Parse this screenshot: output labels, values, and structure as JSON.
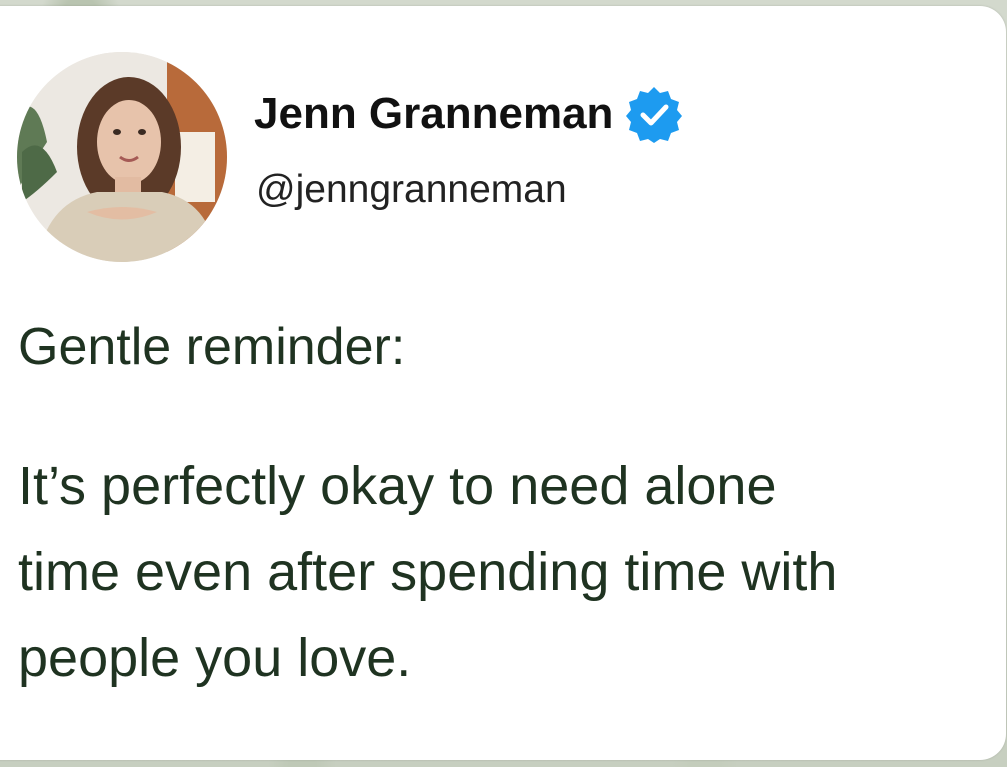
{
  "tweet": {
    "author": {
      "display_name": "Jenn Granneman",
      "handle": "@jenngranneman",
      "verified": true,
      "avatar_icon": "profile-photo"
    },
    "intro": "Gentle reminder:",
    "body_lines": [
      "It’s perfectly okay to need alone",
      "time even after spending time with",
      "people you love."
    ]
  },
  "colors": {
    "verified_badge": "#1d9bf0",
    "text": "#1f3321",
    "card_background": "#ffffff"
  }
}
